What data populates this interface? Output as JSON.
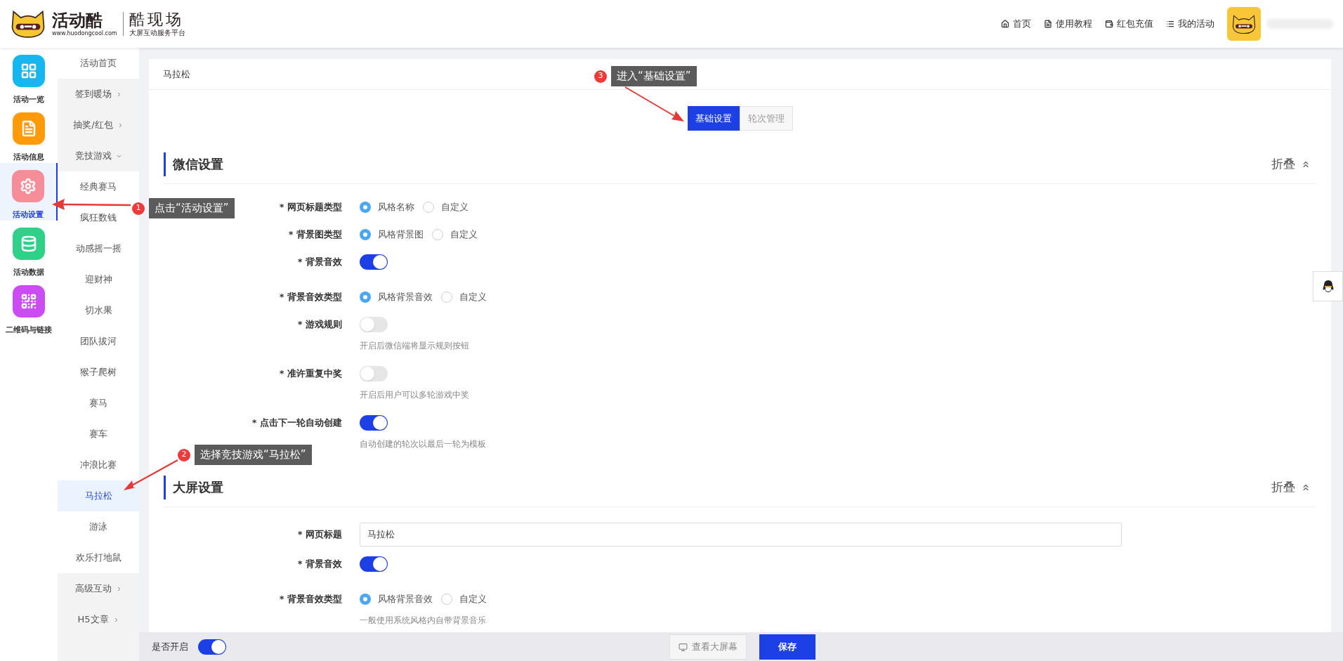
{
  "header": {
    "logo": {
      "name": "活动酷",
      "url": "www.huodongcool.com",
      "product": "酷现场",
      "tagline": "大屏互动服务平台"
    },
    "nav": [
      {
        "kind": "home",
        "label": "首页"
      },
      {
        "kind": "doc",
        "label": "使用教程"
      },
      {
        "kind": "wallet",
        "label": "红包充值"
      },
      {
        "kind": "list",
        "label": "我的活动"
      }
    ]
  },
  "sidebar": {
    "items": [
      {
        "kind": "grid",
        "label": "活动一览",
        "color": "#17b6ee",
        "selected": false
      },
      {
        "kind": "doc",
        "label": "活动信息",
        "color": "#ff9a0a",
        "selected": false
      },
      {
        "kind": "gear",
        "label": "活动设置",
        "color": "#f88d9a",
        "selected": true
      },
      {
        "kind": "database",
        "label": "活动数据",
        "color": "#2fd188",
        "selected": false
      },
      {
        "kind": "qr",
        "label": "二维码与链接",
        "color": "#cb4cf2",
        "selected": false
      }
    ]
  },
  "submenu": {
    "items": [
      {
        "kind": "link",
        "label": "活动首页"
      },
      {
        "kind": "group",
        "label": "签到暖场",
        "expanded": false
      },
      {
        "kind": "group",
        "label": "抽奖/红包",
        "expanded": false
      },
      {
        "kind": "group",
        "label": "竞技游戏",
        "expanded": true,
        "children": [
          {
            "label": "经典赛马",
            "selected": false
          },
          {
            "label": "疯狂数钱",
            "selected": false
          },
          {
            "label": "动感摇一摇",
            "selected": false
          },
          {
            "label": "迎财神",
            "selected": false
          },
          {
            "label": "切水果",
            "selected": false
          },
          {
            "label": "团队拔河",
            "selected": false
          },
          {
            "label": "猴子爬树",
            "selected": false
          },
          {
            "label": "赛马",
            "selected": false
          },
          {
            "label": "赛车",
            "selected": false
          },
          {
            "label": "冲浪比赛",
            "selected": false
          },
          {
            "label": "马拉松",
            "selected": true
          },
          {
            "label": "游泳",
            "selected": false
          },
          {
            "label": "欢乐打地鼠",
            "selected": false
          }
        ]
      },
      {
        "kind": "group",
        "label": "高级互动",
        "expanded": false
      },
      {
        "kind": "group",
        "label": "H5文章",
        "expanded": false
      }
    ]
  },
  "card": {
    "title": "马拉松",
    "tabs": [
      {
        "label": "基础设置",
        "selected": true
      },
      {
        "label": "轮次管理",
        "selected": false
      }
    ],
    "sections": [
      {
        "title": "微信设置",
        "collapse": "折叠",
        "fields": [
          {
            "kind": "radio",
            "label": "* 网页标题类型",
            "options": [
              {
                "label": "风格名称",
                "selected": true
              },
              {
                "label": "自定义",
                "selected": false
              }
            ]
          },
          {
            "kind": "radio",
            "label": "* 背景图类型",
            "options": [
              {
                "label": "风格背景图",
                "selected": true
              },
              {
                "label": "自定义",
                "selected": false
              }
            ]
          },
          {
            "kind": "switch",
            "label": "* 背景音效",
            "on": true
          },
          {
            "kind": "radio",
            "label": "* 背景音效类型",
            "options": [
              {
                "label": "风格背景音效",
                "selected": true
              },
              {
                "label": "自定义",
                "selected": false
              }
            ]
          },
          {
            "kind": "switch",
            "label": "* 游戏规则",
            "on": false,
            "hint": "开启后微信端将显示规则按钮"
          },
          {
            "kind": "switch",
            "label": "* 准许重复中奖",
            "on": false,
            "hint": "开启后用户可以多轮游戏中奖"
          },
          {
            "kind": "switch",
            "label": "* 点击下一轮自动创建",
            "on": true,
            "hint": "自动创建的轮次以最后一轮为模板"
          }
        ]
      },
      {
        "title": "大屏设置",
        "collapse": "折叠",
        "fields": [
          {
            "kind": "text",
            "label": "* 网页标题",
            "value": "马拉松"
          },
          {
            "kind": "switch",
            "label": "* 背景音效",
            "on": true
          },
          {
            "kind": "radio",
            "label": "* 背景音效类型",
            "options": [
              {
                "label": "风格背景音效",
                "selected": true
              },
              {
                "label": "自定义",
                "selected": false
              }
            ],
            "hint": "一般使用系统风格内自带背景音乐"
          }
        ]
      }
    ]
  },
  "bottom_bar": {
    "enable_label": "是否开启",
    "enabled": true,
    "preview_button": "查看大屏幕",
    "save_button": "保存"
  },
  "annotations": [
    {
      "number": "1",
      "text": "点击“活动设置”"
    },
    {
      "number": "2",
      "text": "选择竞技游戏“马拉松”"
    },
    {
      "number": "3",
      "text": "进入“基础设置”"
    }
  ]
}
